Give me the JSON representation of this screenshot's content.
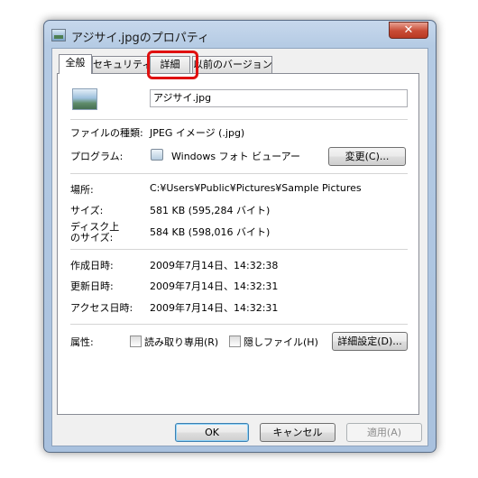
{
  "window": {
    "title": "アジサイ.jpgのプロパティ",
    "close_label": "✕"
  },
  "tabs": [
    {
      "label": "全般",
      "active": true
    },
    {
      "label": "セキュリティ",
      "active": false
    },
    {
      "label": "詳細",
      "active": false
    },
    {
      "label": "以前のバージョン",
      "active": false
    }
  ],
  "general": {
    "file_name": "アジサイ.jpg",
    "file_type_label": "ファイルの種類:",
    "file_type_value": "JPEG イメージ (.jpg)",
    "program_label": "プログラム:",
    "program_value": "Windows フォト ビューアー",
    "change_button": "変更(C)...",
    "location_label": "場所:",
    "location_value": "C:¥Users¥Public¥Pictures¥Sample Pictures",
    "size_label": "サイズ:",
    "size_value": "581 KB (595,284 バイト)",
    "disk_size_label_1": "ディスク上",
    "disk_size_label_2": "のサイズ:",
    "disk_size_value": "584 KB (598,016 バイト)",
    "created_label": "作成日時:",
    "created_value": "2009年7月14日、14:32:38",
    "modified_label": "更新日時:",
    "modified_value": "2009年7月14日、14:32:31",
    "accessed_label": "アクセス日時:",
    "accessed_value": "2009年7月14日、14:32:31",
    "attributes_label": "属性:",
    "readonly_label": "読み取り専用(R)",
    "hidden_label": "隠しファイル(H)",
    "advanced_button": "詳細設定(D)..."
  },
  "footer": {
    "ok": "OK",
    "cancel": "キャンセル",
    "apply": "適用(A)"
  },
  "colors": {
    "highlight": "#e01010",
    "close_button": "#c84a34"
  }
}
